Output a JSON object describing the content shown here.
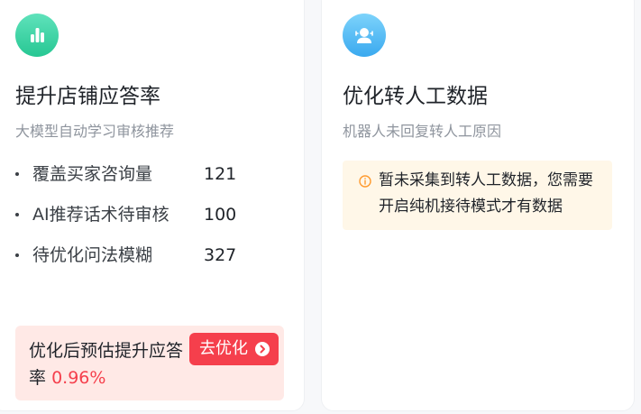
{
  "cards": {
    "left": {
      "icon": "bar-chart-icon",
      "icon_color": "#27c793",
      "title": "提升店铺应答率",
      "subtitle": "大模型自动学习审核推荐",
      "metrics": [
        {
          "label": "覆盖买家咨询量",
          "value": "121"
        },
        {
          "label": "AI推荐话术待审核",
          "value": "100"
        },
        {
          "label": "待优化问法模糊",
          "value": "327"
        }
      ],
      "optimize": {
        "text": "优化后预估提升应答率",
        "rate": "0.96%",
        "button_label": "去优化",
        "button_icon": "chevron-right-circle-icon",
        "accent_color": "#f53f4c"
      }
    },
    "right": {
      "icon": "agent-headset-icon",
      "icon_color": "#3aa9ef",
      "title": "优化转人工数据",
      "subtitle": "机器人未回复转人工原因",
      "notice": {
        "icon": "info-circle-icon",
        "icon_color": "#ff9a2e",
        "text": "暂未采集到转人工数据，您需要开启纯机接待模式才有数据"
      }
    }
  }
}
